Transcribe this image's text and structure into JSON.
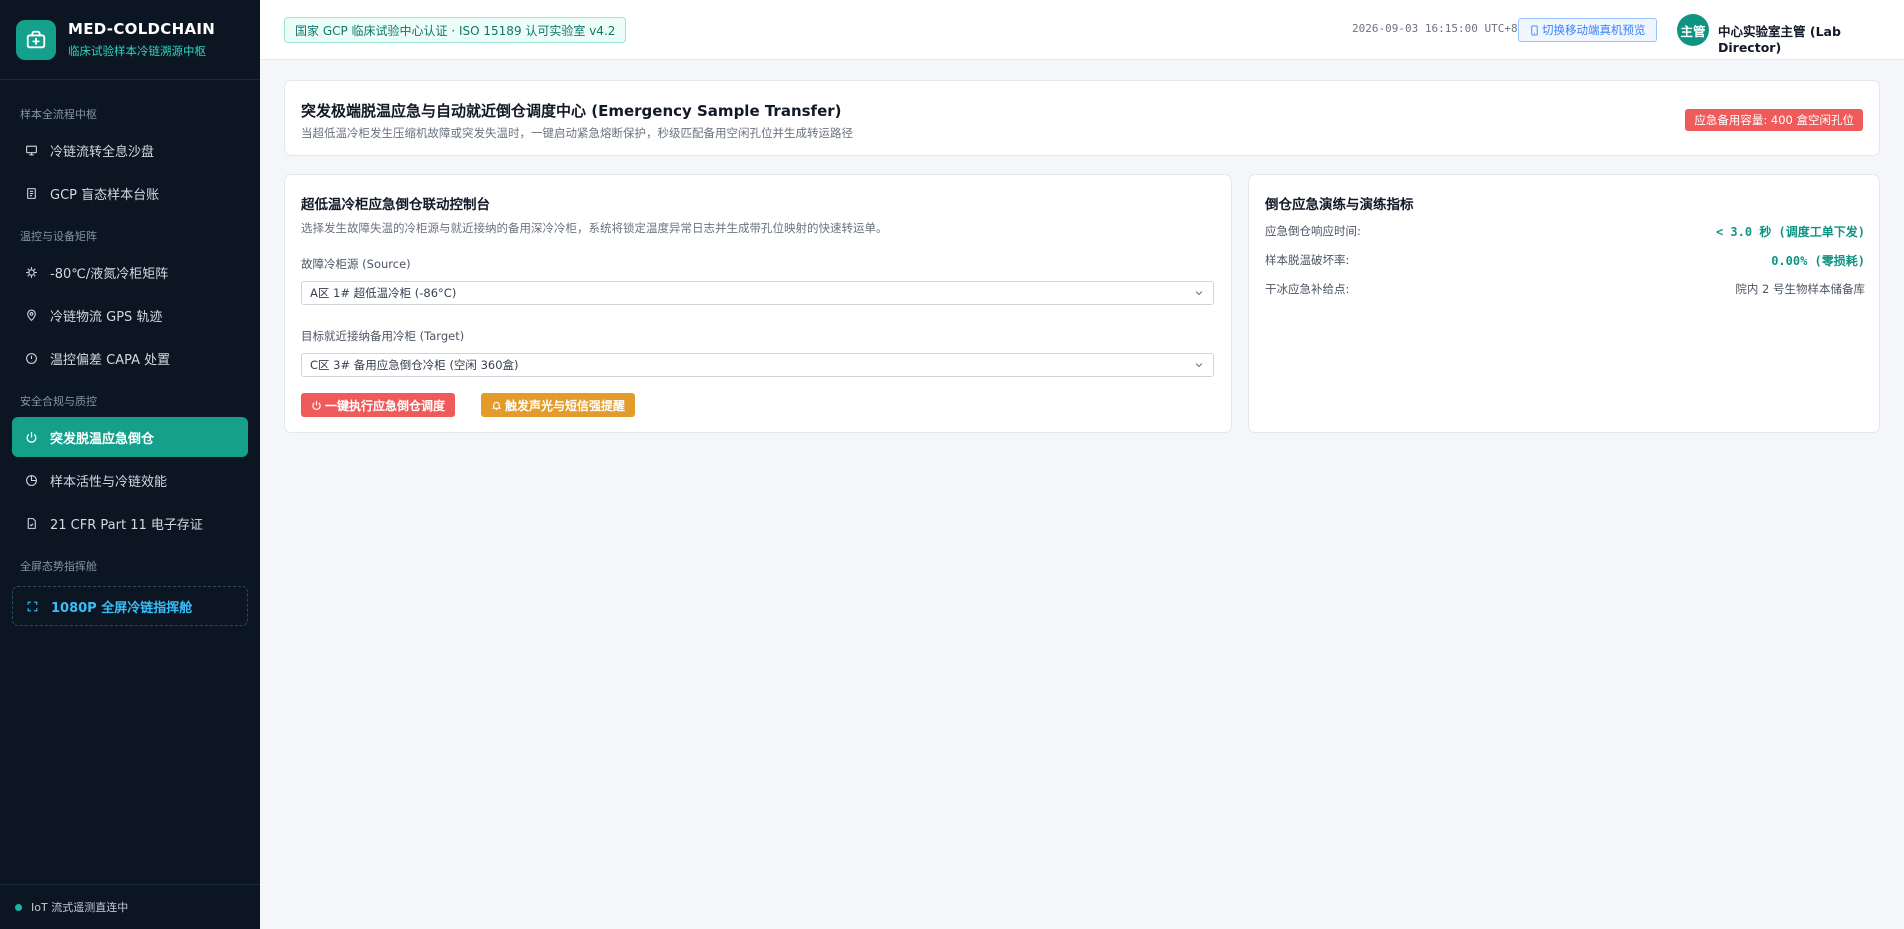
{
  "brand": {
    "title": "MED-COLDCHAIN",
    "subtitle": "临床试验样本冷链溯源中枢",
    "accent": "#14a08b"
  },
  "sidebar": {
    "groups": [
      {
        "label": "样本全流程中枢",
        "items": [
          {
            "label": "冷链流转全息沙盘",
            "icon": "monitor-icon"
          },
          {
            "label": "GCP 盲态样本台账",
            "icon": "document-icon"
          }
        ]
      },
      {
        "label": "温控与设备矩阵",
        "items": [
          {
            "label": "-80℃/液氮冷柜矩阵",
            "icon": "cpu-icon"
          },
          {
            "label": "冷链物流 GPS 轨迹",
            "icon": "map-pin-icon"
          },
          {
            "label": "温控偏差 CAPA 处置",
            "icon": "alert-circle-icon"
          }
        ]
      },
      {
        "label": "安全合规与质控",
        "items": [
          {
            "label": "突发脱温应急倒仓",
            "icon": "power-icon",
            "active": true
          },
          {
            "label": "样本活性与冷链效能",
            "icon": "pie-chart-icon"
          },
          {
            "label": "21 CFR Part 11 电子存证",
            "icon": "file-check-icon"
          }
        ]
      },
      {
        "label": "全屏态势指挥舱",
        "items": [
          {
            "label": "1080P 全屏冷链指挥舱",
            "icon": "fullscreen-icon"
          }
        ]
      }
    ],
    "footer_status": "IoT 流式遥测直连中"
  },
  "header": {
    "certification": "国家 GCP 临床试验中心认证 · ISO 15189 认可实验室 v4.2",
    "datetime": "2026-09-03 16:15:00 UTC+8",
    "mobile_preview": "切换移动端真机预览",
    "avatar_text": "主管",
    "user_name": "中心实验室主管 (Lab Director)"
  },
  "banner": {
    "title": "突发极端脱温应急与自动就近倒仓调度中心 (Emergency Sample Transfer)",
    "subtitle": "当超低温冷柜发生压缩机故障或突发失温时，一键启动紧急熔断保护，秒级匹配备用空闲孔位并生成转运路径",
    "capacity_badge": "应急备用容量: 400 盒空闲孔位"
  },
  "console": {
    "title": "超低温冷柜应急倒仓联动控制台",
    "description": "选择发生故障失温的冷柜源与就近接纳的备用深冷冷柜，系统将锁定温度异常日志并生成带孔位映射的快速转运单。",
    "source_label": "故障冷柜源 (Source)",
    "source_value": "A区 1# 超低温冷柜 (-86°C)",
    "target_label": "目标就近接纳备用冷柜 (Target)",
    "target_value": "C区 3# 备用应急倒仓冷柜 (空闲 360盒)",
    "execute_button": "一键执行应急倒仓调度",
    "alarm_button": "触发声光与短信强提醒"
  },
  "metrics": {
    "title": "倒仓应急演练与演练指标",
    "rows": [
      {
        "label": "应急倒仓响应时间:",
        "value": "< 3.0 秒 (调度工单下发)"
      },
      {
        "label": "样本脱温破坏率:",
        "value": "0.00% (零损耗)"
      },
      {
        "label": "干冰应急补给点:",
        "value": "院内 2 号生物样本储备库"
      }
    ]
  },
  "colors": {
    "sidebar_bg": "#0b1622",
    "accent": "#14a08b",
    "danger": "#ef5b5b",
    "warning": "#e39b2c",
    "info": "#3b82f6"
  }
}
